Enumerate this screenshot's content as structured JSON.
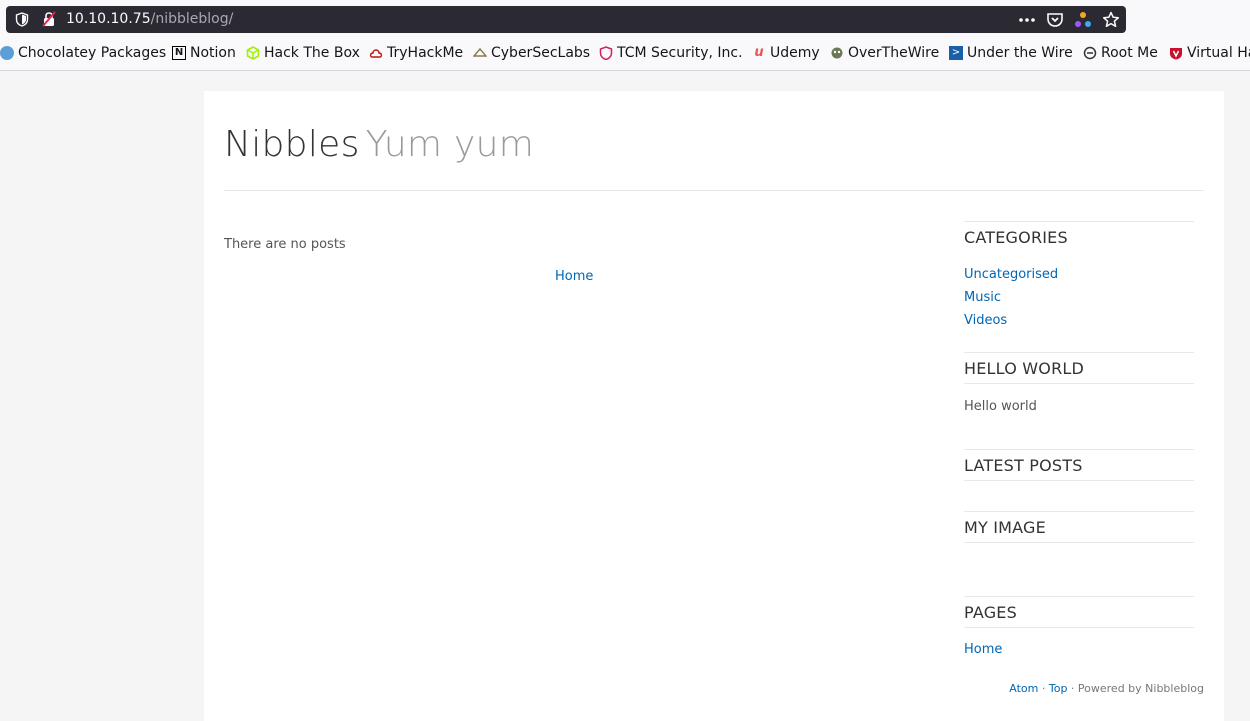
{
  "browser": {
    "url_host": "10.10.10.75",
    "url_path": "/nibbleblog/",
    "bookmarks": [
      {
        "label": "Chocolatey Packages",
        "icon": "chocolatey-icon",
        "color": "#5c9fd8"
      },
      {
        "label": "Notion",
        "icon": "notion-icon",
        "color": "#000000"
      },
      {
        "label": "Hack The Box",
        "icon": "hackthebox-icon",
        "color": "#9fef00"
      },
      {
        "label": "TryHackMe",
        "icon": "tryhackme-icon",
        "color": "#c11111"
      },
      {
        "label": "CyberSecLabs",
        "icon": "cyberseclabs-icon",
        "color": "#8a7a4a"
      },
      {
        "label": "TCM Security, Inc.",
        "icon": "tcm-icon",
        "color": "#d1205a"
      },
      {
        "label": "Udemy",
        "icon": "udemy-icon",
        "color": "#ec5252"
      },
      {
        "label": "OverTheWire",
        "icon": "overthewire-icon",
        "color": "#4a5a3a"
      },
      {
        "label": "Under the Wire",
        "icon": "underthewire-icon",
        "color": "#1b5fa8"
      },
      {
        "label": "Root Me",
        "icon": "rootme-icon",
        "color": "#333333"
      },
      {
        "label": "Virtual Ha",
        "icon": "virtualhacking-icon",
        "color": "#c8102e"
      }
    ]
  },
  "blog": {
    "title": "Nibbles",
    "slogan": "Yum yum",
    "no_posts": "There are no posts",
    "pager_home": "Home"
  },
  "sidebar": {
    "categories_title": "CATEGORIES",
    "categories": [
      "Uncategorised",
      "Music",
      "Videos"
    ],
    "hello_title": "HELLO WORLD",
    "hello_text": "Hello world",
    "latest_title": "LATEST POSTS",
    "image_title": "MY IMAGE",
    "pages_title": "PAGES",
    "pages": [
      "Home"
    ]
  },
  "footer": {
    "atom": "Atom",
    "sep1": " · ",
    "top": "Top",
    "powered": " · Powered by Nibbleblog"
  },
  "colors": {
    "link": "#0066b3",
    "urlbar_bg": "#2b2a33"
  }
}
